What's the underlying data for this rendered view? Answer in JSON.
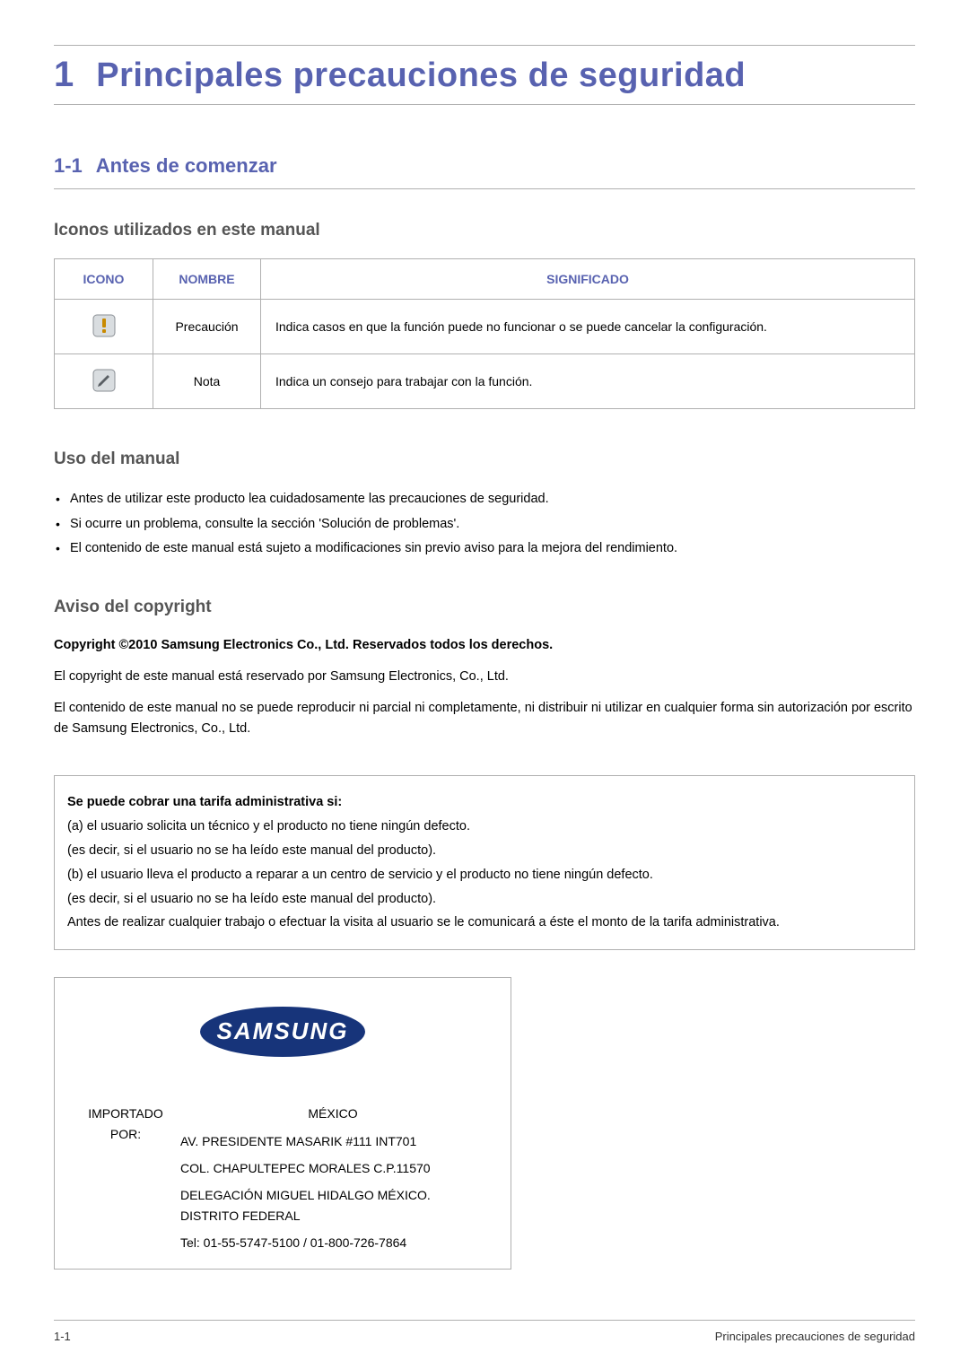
{
  "chapter": {
    "num": "1",
    "title": "Principales precauciones de seguridad"
  },
  "section": {
    "num": "1-1",
    "title": "Antes de comenzar"
  },
  "icons_block": {
    "heading": "Iconos utilizados en este manual",
    "headers": {
      "c1": "ICONO",
      "c2": "NOMBRE",
      "c3": "SIGNIFICADO"
    },
    "rows": [
      {
        "name": "Precaución",
        "meaning": "Indica casos en que la función puede no funcionar o se puede cancelar la configuración."
      },
      {
        "name": "Nota",
        "meaning": "Indica un consejo para trabajar con la función."
      }
    ]
  },
  "usage": {
    "heading": "Uso del manual",
    "items": [
      "Antes de utilizar este producto lea cuidadosamente las precauciones de seguridad.",
      "Si ocurre un problema, consulte la sección 'Solución de problemas'.",
      "El contenido de este manual está sujeto a modificaciones sin previo aviso para la mejora del rendimiento."
    ]
  },
  "copyright": {
    "heading": "Aviso del copyright",
    "line1": "Copyright ©2010 Samsung Electronics Co., Ltd. Reservados todos los derechos.",
    "line2": "El copyright de este manual está reservado por Samsung Electronics, Co., Ltd.",
    "line3": "El contenido de este manual no se puede reproducir ni parcial ni completamente, ni distribuir ni utilizar en cualquier forma sin autorización por escrito de Samsung Electronics, Co., Ltd."
  },
  "fee_box": {
    "title": "Se puede cobrar una tarifa administrativa si:",
    "p1": "(a) el usuario solicita un técnico y el producto no tiene ningún defecto.",
    "p2": "(es decir, si el usuario no se ha leído este manual del producto).",
    "p3": "(b) el usuario lleva el producto a reparar a un centro de servicio y el producto no tiene ningún defecto.",
    "p4": "(es decir, si el usuario no se ha leído este manual del producto).",
    "p5": "Antes de realizar cualquier trabajo o efectuar la visita al usuario se le comunicará a éste el monto de la tarifa administrativa."
  },
  "import": {
    "label": "IMPORTADO POR:",
    "country": "MÉXICO",
    "addr1": "AV. PRESIDENTE MASARIK #111 INT701",
    "addr2": "COL. CHAPULTEPEC MORALES C.P.11570",
    "addr3": "DELEGACIÓN MIGUEL HIDALGO MÉXICO. DISTRITO FEDERAL",
    "tel": "Tel: 01-55-5747-5100 / 01-800-726-7864",
    "logo_text": "SAMSUNG"
  },
  "footer": {
    "left": "1-1",
    "right": "Principales precauciones de seguridad"
  }
}
